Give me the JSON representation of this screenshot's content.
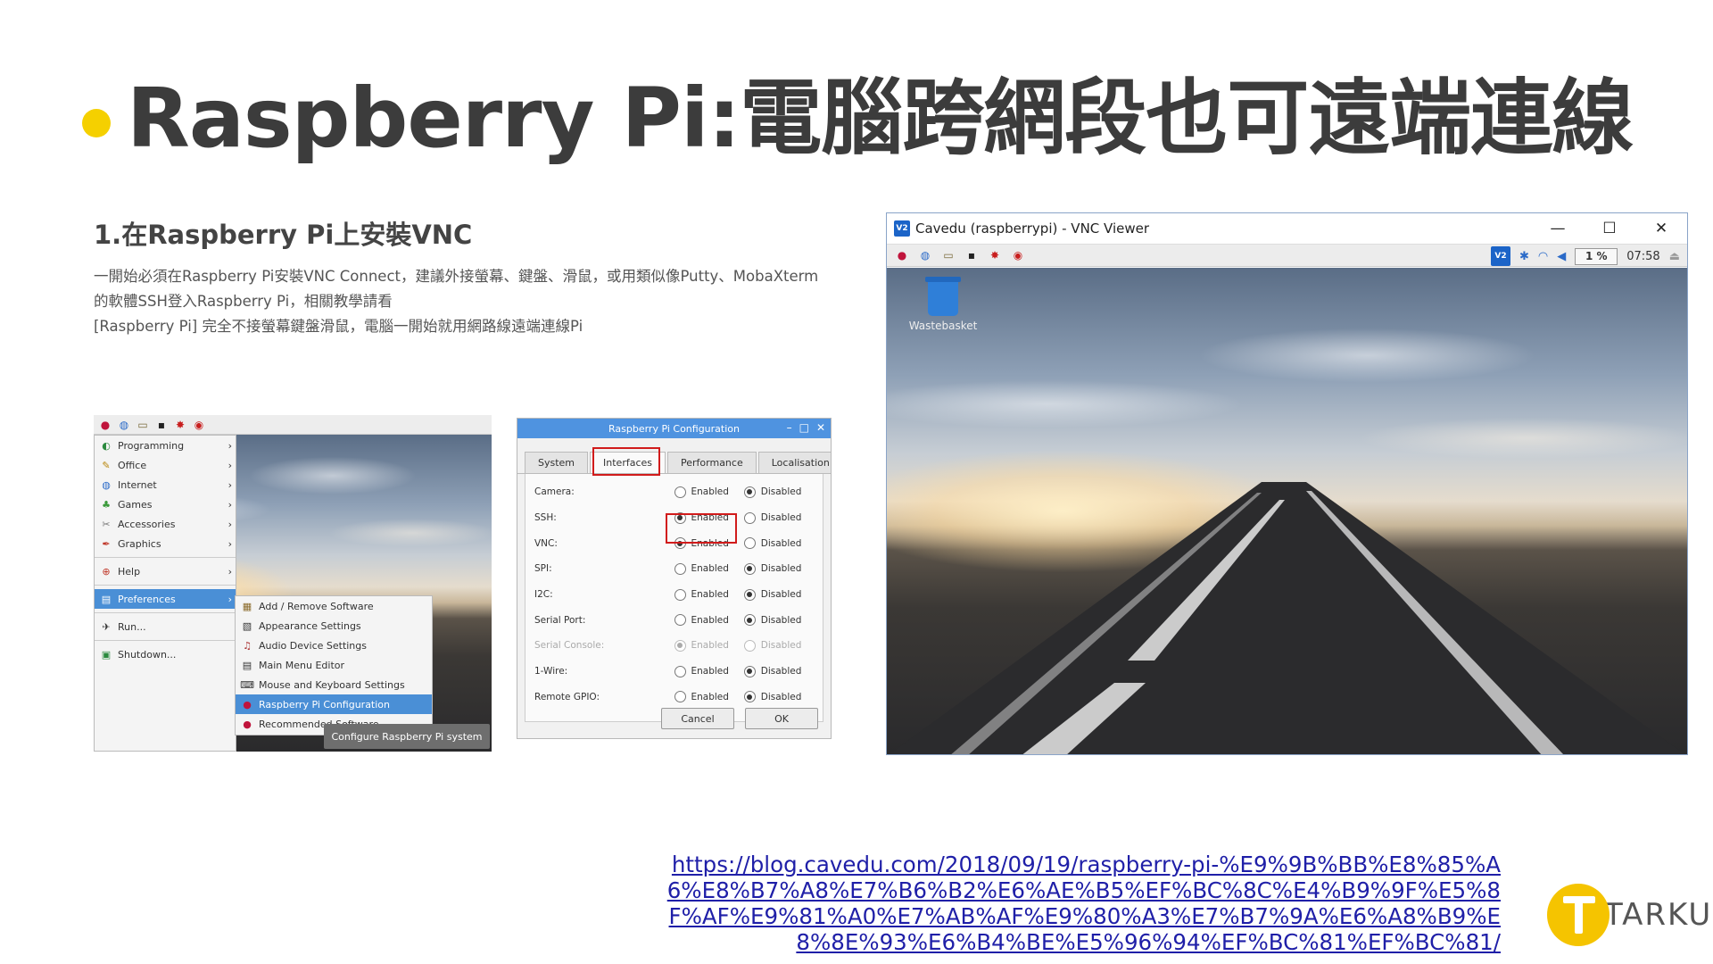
{
  "slide": {
    "title": "Raspberry Pi:電腦跨網段也可遠端連線",
    "step_heading": "1.在Raspberry Pi上安裝VNC",
    "desc_line1": "一開始必須在Raspberry Pi安裝VNC Connect，建議外接螢幕、鍵盤、滑鼠，或用類似像Putty、MobaXterm",
    "desc_line2": "的軟體SSH登入Raspberry Pi，相關教學請看",
    "desc_line3": "[Raspberry Pi] 完全不接螢幕鍵盤滑鼠，電腦一開始就用網路線遠端連線Pi",
    "link": "https://blog.cavedu.com/2018/09/19/raspberry-pi-%E9%9B%BB%E8%85%A6%E8%B7%A8%E7%B6%B2%E6%AE%B5%EF%BC%8C%E4%B9%9F%E5%8F%AF%E9%81%A0%E7%AB%AF%E9%80%A3%E7%B7%9A%E6%A8%B9%E8%8E%93%E6%B4%BE%E5%96%94%EF%BC%81%EF%BC%81/",
    "logo_text": "TARKUS",
    "accent_color": "#f5d000"
  },
  "menu_shot": {
    "items": [
      "Programming",
      "Office",
      "Internet",
      "Games",
      "Accessories",
      "Graphics",
      "Help",
      "Preferences",
      "Run...",
      "Shutdown..."
    ],
    "submenu": [
      "Add / Remove Software",
      "Appearance Settings",
      "Audio Device Settings",
      "Main Menu Editor",
      "Mouse and Keyboard Settings",
      "Raspberry Pi Configuration",
      "Recommended Software"
    ],
    "tooltip": "Configure Raspberry Pi system"
  },
  "config_shot": {
    "title": "Raspberry Pi Configuration",
    "tabs": [
      "System",
      "Interfaces",
      "Performance",
      "Localisation"
    ],
    "enabled_label": "Enabled",
    "disabled_label": "Disabled",
    "rows": [
      {
        "label": "Camera:"
      },
      {
        "label": "SSH:"
      },
      {
        "label": "VNC:"
      },
      {
        "label": "SPI:"
      },
      {
        "label": "I2C:"
      },
      {
        "label": "Serial Port:"
      },
      {
        "label": "Serial Console:"
      },
      {
        "label": "1-Wire:"
      },
      {
        "label": "Remote GPIO:"
      }
    ],
    "cancel": "Cancel",
    "ok": "OK"
  },
  "vnc_shot": {
    "window_title": "Cavedu (raspberrypi) - VNC Viewer",
    "logo": "V2",
    "cpu": "1 %",
    "clock": "07:58",
    "desktop_icon": "Wastebasket"
  }
}
